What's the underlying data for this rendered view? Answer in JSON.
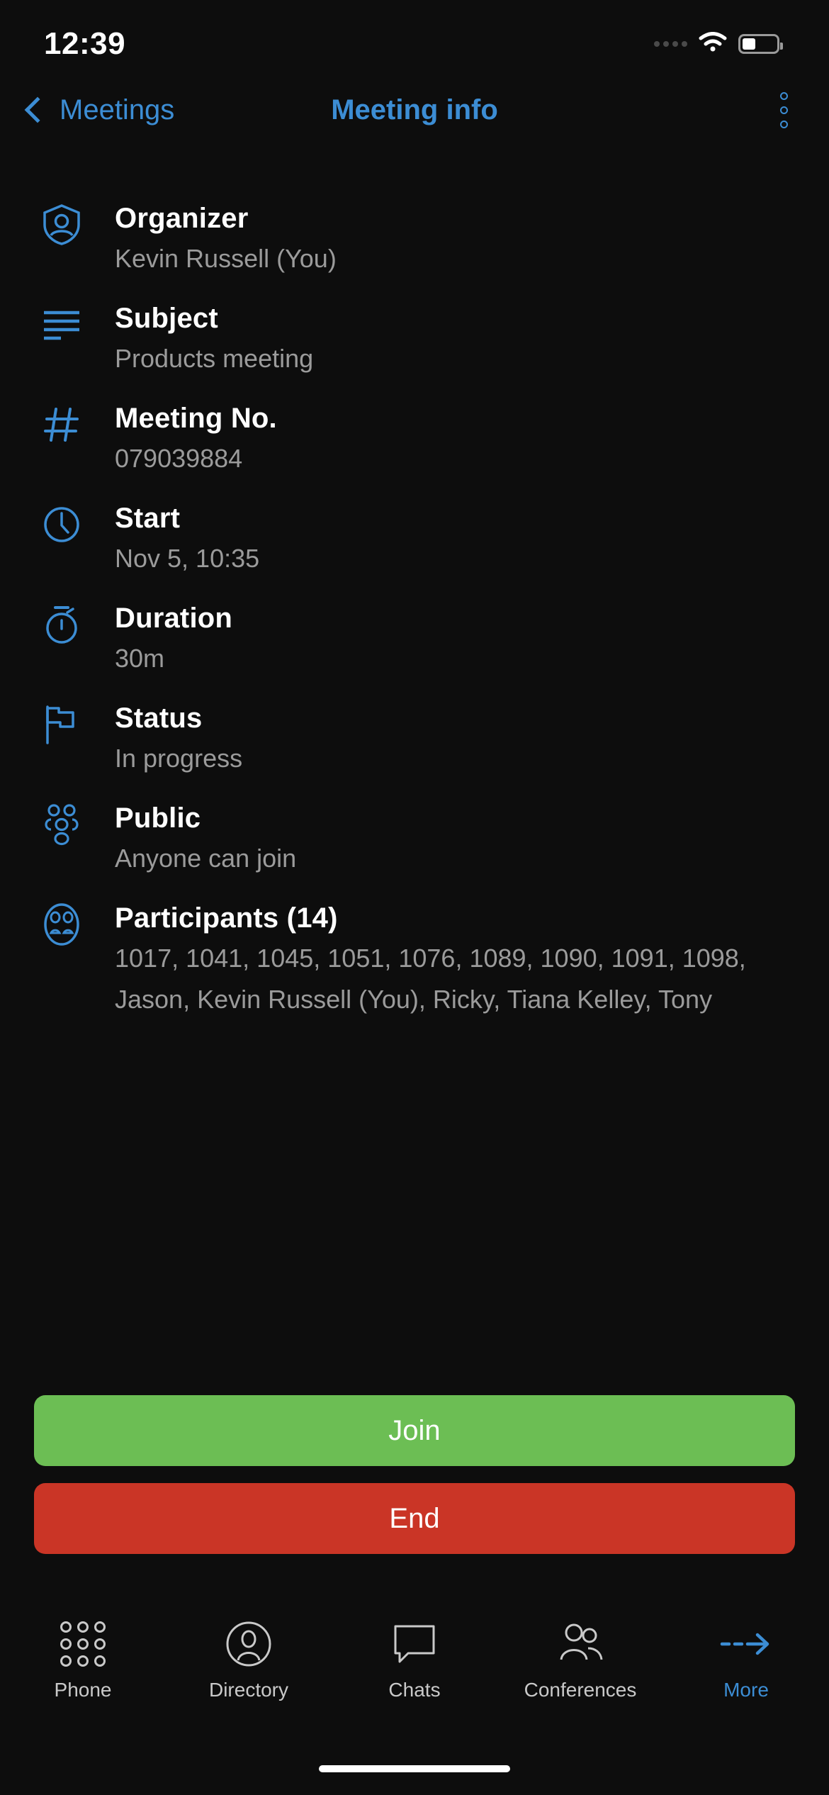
{
  "status_bar": {
    "time": "12:39",
    "signal_icon": "signal-dots-icon",
    "wifi_icon": "wifi-icon",
    "battery_icon": "battery-icon",
    "battery_level_percent": 40
  },
  "nav": {
    "back_icon": "chevron-left-icon",
    "back_label": "Meetings",
    "title": "Meeting info",
    "more_icon": "more-vertical-icon"
  },
  "colors": {
    "accent_blue": "#3c8dd4",
    "background": "#0d0d0d",
    "label_white": "#ffffff",
    "value_gray": "#9b9b9b",
    "join_green": "#6cbe54",
    "end_red": "#ca3526"
  },
  "info_rows": [
    {
      "icon": "shield-person-icon",
      "label": "Organizer",
      "value": "Kevin Russell (You)"
    },
    {
      "icon": "text-lines-icon",
      "label": "Subject",
      "value": "Products meeting"
    },
    {
      "icon": "hash-icon",
      "label": "Meeting No.",
      "value": "079039884"
    },
    {
      "icon": "clock-icon",
      "label": "Start",
      "value": "Nov 5, 10:35"
    },
    {
      "icon": "stopwatch-icon",
      "label": "Duration",
      "value": "30m"
    },
    {
      "icon": "flag-icon",
      "label": "Status",
      "value": "In progress"
    },
    {
      "icon": "people-group-icon",
      "label": "Public",
      "value": "Anyone can join"
    },
    {
      "icon": "participants-icon",
      "label": "Participants (14)",
      "value": "1017, 1041, 1045, 1051, 1076, 1089, 1090, 1091, 1098, Jason, Kevin Russell (You), Ricky, Tiana Kelley, Tony"
    }
  ],
  "actions": {
    "join_label": "Join",
    "end_label": "End"
  },
  "tabs": [
    {
      "icon": "keypad-icon",
      "label": "Phone",
      "active": false
    },
    {
      "icon": "person-circle-icon",
      "label": "Directory",
      "active": false
    },
    {
      "icon": "chat-bubble-icon",
      "label": "Chats",
      "active": false
    },
    {
      "icon": "people-icon",
      "label": "Conferences",
      "active": false
    },
    {
      "icon": "arrow-more-icon",
      "label": "More",
      "active": true
    }
  ]
}
